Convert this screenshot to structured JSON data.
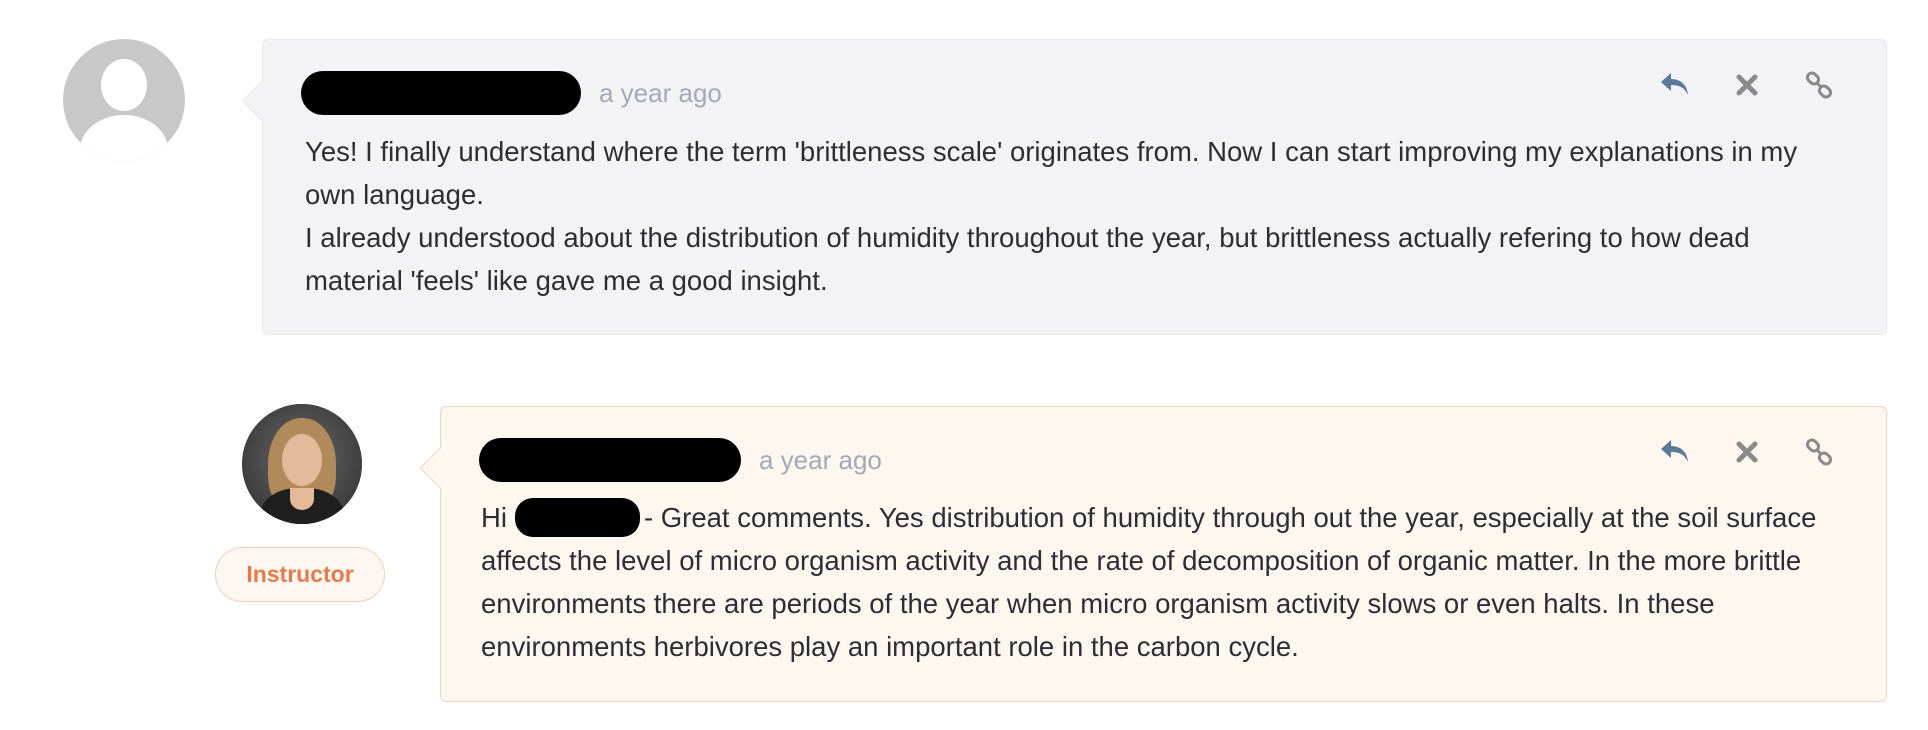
{
  "comments": [
    {
      "time": "a year ago",
      "paragraphs": [
        "Yes! I finally understand where the term 'brittleness scale' originates from. Now I can start improving my explanations in my own language.",
        "I already understood about the distribution of humidity throughout the year, but brittleness actually refering to how dead material 'feels' like gave me a good insight."
      ]
    },
    {
      "time": "a year ago",
      "badge": "Instructor",
      "greeting": "Hi",
      "body_rest": "- Great comments.  Yes distribution of humidity through out the year, especially at the soil surface affects the level of micro organism activity and the rate of decomposition of organic matter.  In the more brittle environments there are periods of the year when micro organism activity slows or even halts.  In these environments herbivores play an important role in the carbon cycle."
    }
  ],
  "icons": {
    "reply": "reply-icon",
    "delete": "close-icon",
    "link": "link-icon"
  },
  "colors": {
    "icon_reply": "#5b7a99",
    "icon_muted": "#8a8a8a",
    "instructor_accent": "#e8794a",
    "card_default_bg": "#f3f3f6",
    "card_instructor_bg": "#fdf7f0"
  }
}
